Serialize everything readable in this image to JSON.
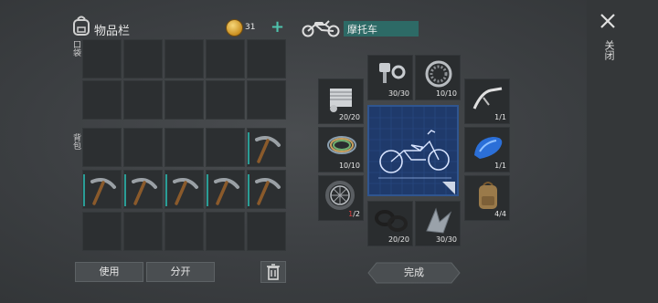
{
  "inventory": {
    "title": "物品栏",
    "coins": "31",
    "plus_label": "+",
    "pocket_label": "口袋",
    "backpack_label": "背包",
    "use_label": "使用",
    "split_label": "分开"
  },
  "crafting": {
    "target_name": "摩托车",
    "close_label": "关闭",
    "done_label": "完成",
    "parts": [
      {
        "name": "bolts",
        "count": "30/30"
      },
      {
        "name": "bearing",
        "count": "10/10"
      },
      {
        "name": "engine",
        "count": "20/20"
      },
      {
        "name": "handlebar",
        "count": "1/1"
      },
      {
        "name": "wire",
        "count": "10/10"
      },
      {
        "name": "fuel-tank",
        "count": "1/1"
      },
      {
        "name": "wheel",
        "count_have": "1",
        "count_need": "/2"
      },
      {
        "name": "backpack",
        "count": "4/4"
      },
      {
        "name": "rubber-rings",
        "count": "20/20"
      },
      {
        "name": "metal-scrap",
        "count": "30/30"
      }
    ]
  },
  "colors": {
    "accent": "#2a9d96",
    "label_bg": "#2d6a66",
    "missing": "#e04040"
  }
}
